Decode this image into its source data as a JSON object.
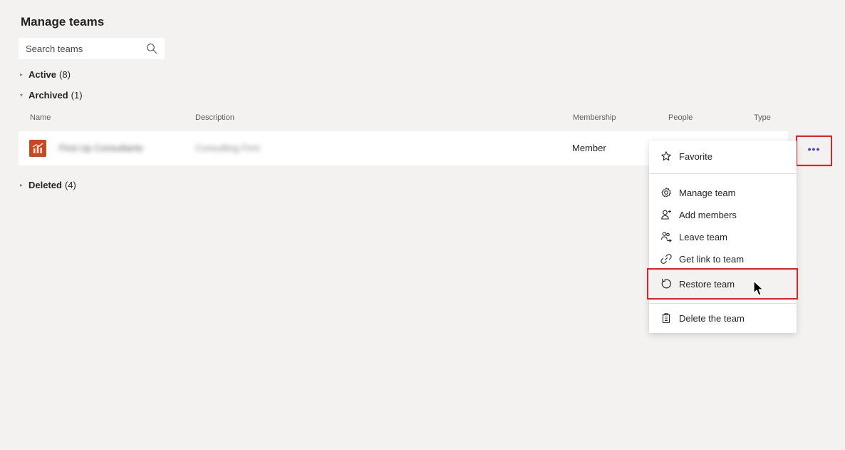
{
  "page": {
    "title": "Manage teams"
  },
  "search": {
    "placeholder": "Search teams"
  },
  "sections": {
    "active": {
      "label": "Active",
      "count": "(8)"
    },
    "archived": {
      "label": "Archived",
      "count": "(1)"
    },
    "deleted": {
      "label": "Deleted",
      "count": "(4)"
    }
  },
  "table": {
    "columns": [
      "Name",
      "Description",
      "Membership",
      "People",
      "Type"
    ],
    "rows": [
      {
        "name": "First Up Consultants",
        "description": "Consulting Firm",
        "membership": "Member"
      }
    ]
  },
  "more_button": {
    "label": "•••"
  },
  "context_menu": {
    "items": [
      {
        "label": "Favorite",
        "icon": "star-icon"
      },
      {
        "label": "Manage team",
        "icon": "gear-icon"
      },
      {
        "label": "Add members",
        "icon": "add-person-icon"
      },
      {
        "label": "Leave team",
        "icon": "leave-icon"
      },
      {
        "label": "Get link to team",
        "icon": "link-icon"
      },
      {
        "label": "Restore team",
        "icon": "restore-icon"
      },
      {
        "label": "Delete the team",
        "icon": "trash-icon"
      }
    ]
  },
  "colors": {
    "background": "#f3f2f1",
    "accent": "#464eb8",
    "highlight": "#e61e25",
    "team_logo": "#c8491f"
  }
}
